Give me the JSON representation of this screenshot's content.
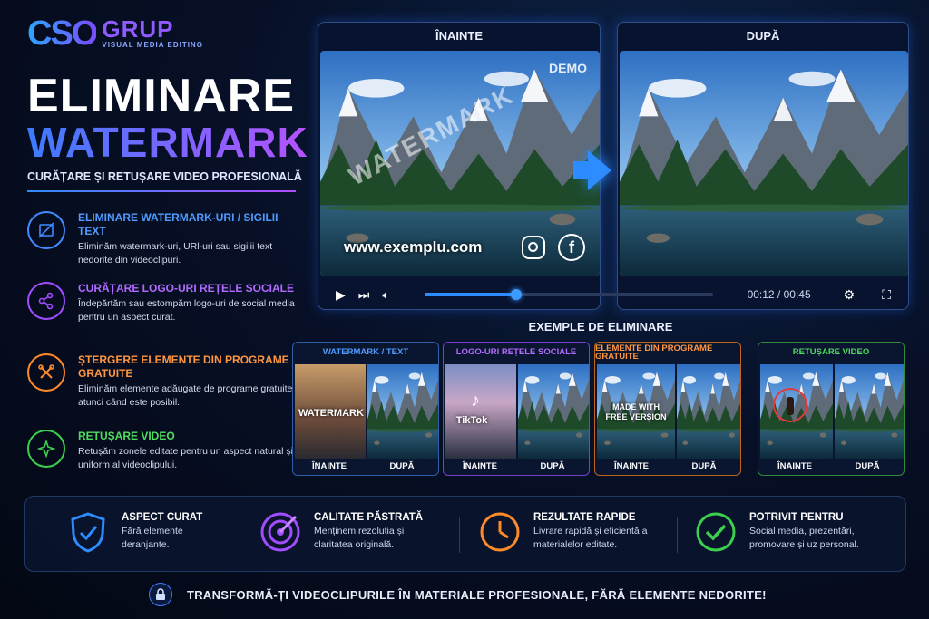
{
  "brand": {
    "mark": "CSO",
    "name": "GRUP",
    "tagline": "VISUAL MEDIA EDITING"
  },
  "hero": {
    "line1": "ELIMINARE",
    "line2": "WATERMARK",
    "subtitle": "CURĂȚARE ȘI RETUȘARE VIDEO PROFESIONALĂ"
  },
  "features": [
    {
      "title": "ELIMINARE WATERMARK-URI / SIGILII TEXT",
      "desc": "Eliminăm watermark-uri, URl-uri sau sigilii text nedorite din videoclipuri.",
      "color": "#3f8cff",
      "icon": "no-image-icon"
    },
    {
      "title": "CURĂȚARE LOGO-URI REȚELE SOCIALE",
      "desc": "Îndepărtăm sau estompăm logo-uri de social media pentru un aspect curat.",
      "color": "#a24cff",
      "icon": "share-icon"
    },
    {
      "title": "ȘTERGERE ELEMENTE DIN PROGRAME GRATUITE",
      "desc": "Eliminăm elemente adăugate de programe gratuite atunci când este posibil.",
      "color": "#ff8a2a",
      "icon": "tools-icon"
    },
    {
      "title": "RETUȘARE VIDEO",
      "desc": "Retușăm zonele editate pentru un aspect natural și uniform al videoclipului.",
      "color": "#3ccf4e",
      "icon": "sparkle-icon"
    }
  ],
  "before_panel": {
    "label": "ÎNAINTE",
    "watermark": "WATERMARK",
    "demo": "DEMO",
    "url": "www.exemplu.com"
  },
  "after_panel": {
    "label": "DUPĂ"
  },
  "player": {
    "time": "00:12 / 00:45",
    "progress": 0.32
  },
  "examples": {
    "title": "EXEMPLE DE ELIMINARE",
    "before_label": "ÎNAINTE",
    "after_label": "DUPĂ",
    "cards": [
      {
        "title": "WATERMARK / TEXT",
        "overlay": "WATERMARK",
        "color": "#3f8cff"
      },
      {
        "title": "LOGO-URI REȚELE SOCIALE",
        "overlay": "TikTok",
        "color": "#a24cff"
      },
      {
        "title": "ELEMENTE DIN PROGRAME GRATUITE",
        "overlay": "MADE WITH\nFREE VERSION",
        "color": "#ff8a2a"
      },
      {
        "title": "RETUȘARE VIDEO",
        "overlay": "",
        "color": "#3ccf4e"
      }
    ]
  },
  "benefits": [
    {
      "title": "ASPECT CURAT",
      "desc": "Fără elemente deranjante.",
      "color": "#2d8cff",
      "icon": "shield-check-icon"
    },
    {
      "title": "CALITATE PĂSTRATĂ",
      "desc": "Menținem rezoluția și claritatea originală.",
      "color": "#a24cff",
      "icon": "target-icon"
    },
    {
      "title": "REZULTATE RAPIDE",
      "desc": "Livrare rapidă și eficientă a materialelor editate.",
      "color": "#ff8a2a",
      "icon": "clock-icon"
    },
    {
      "title": "POTRIVIT PENTRU",
      "desc": "Social media, prezentări, promovare și uz personal.",
      "color": "#3ccf4e",
      "icon": "check-circle-icon"
    }
  ],
  "footer": {
    "text": "TRANSFORMĂ-ȚI VIDEOCLIPURILE ÎN MATERIALE PROFESIONALE, FĂRĂ ELEMENTE NEDORITE!"
  }
}
